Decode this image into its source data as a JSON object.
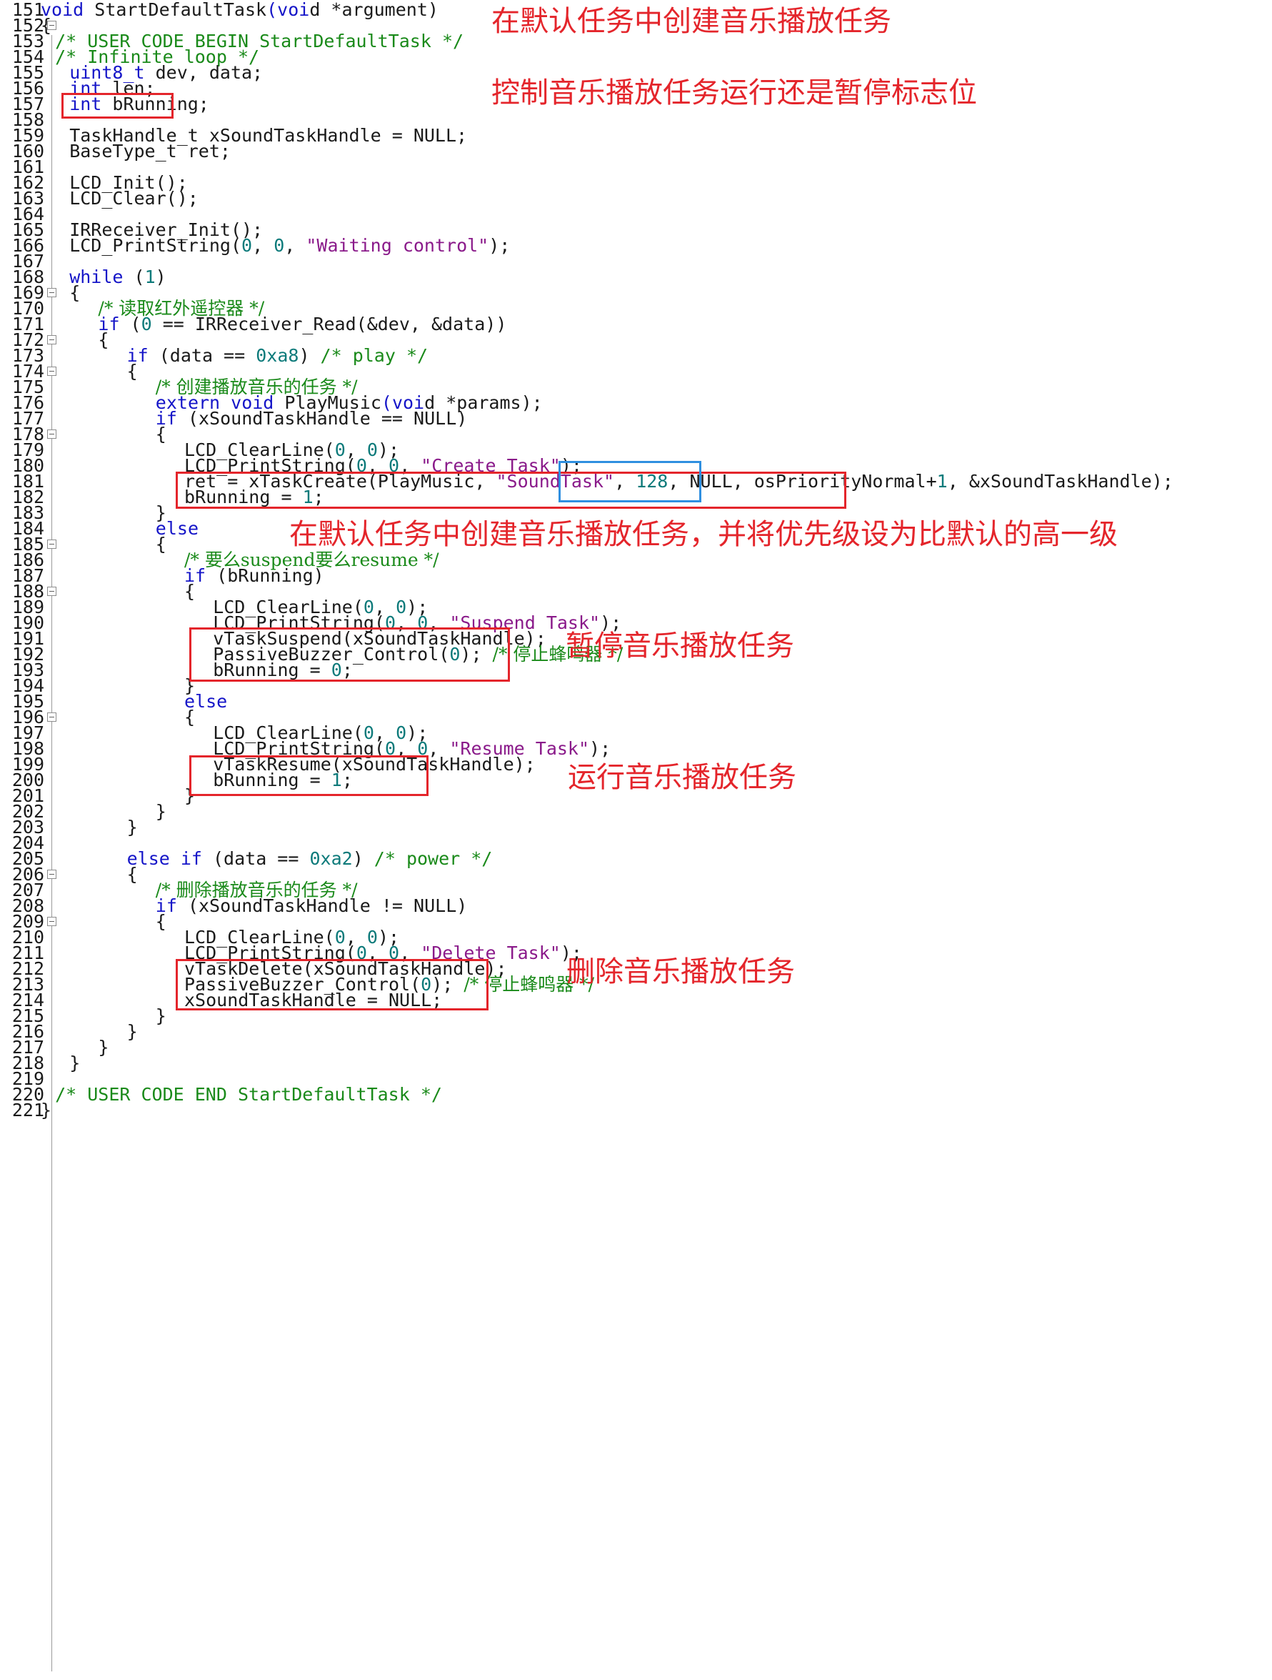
{
  "lines": {
    "l151": {
      "n": "151",
      "t": "void StartDefaultTask(void *argument)"
    },
    "l152": {
      "n": "152",
      "t": "{"
    },
    "l153": {
      "n": "153",
      "t": "/* USER CODE BEGIN StartDefaultTask */"
    },
    "l154": {
      "n": "154",
      "t": "/* Infinite loop */"
    },
    "l155": {
      "n": "155",
      "t": "uint8_t dev, data;"
    },
    "l156": {
      "n": "156",
      "t": "int len;"
    },
    "l157": {
      "n": "157",
      "t": "int bRunning;"
    },
    "l158": {
      "n": "158",
      "t": ""
    },
    "l159": {
      "n": "159",
      "t": "TaskHandle_t xSoundTaskHandle = NULL;"
    },
    "l160": {
      "n": "160",
      "t": "BaseType_t ret;"
    },
    "l161": {
      "n": "161",
      "t": ""
    },
    "l162": {
      "n": "162",
      "t": "LCD_Init();"
    },
    "l163": {
      "n": "163",
      "t": "LCD_Clear();"
    },
    "l164": {
      "n": "164",
      "t": ""
    },
    "l165": {
      "n": "165",
      "t": "IRReceiver_Init();"
    },
    "l166": {
      "n": "166",
      "t": "LCD_PrintString(0, 0, \"Waiting control\");"
    },
    "l167": {
      "n": "167",
      "t": ""
    },
    "l168": {
      "n": "168",
      "t": "while (1)"
    },
    "l169": {
      "n": "169",
      "t": "{"
    },
    "l170": {
      "n": "170",
      "t": "/* 读取红外遥控器 */"
    },
    "l171": {
      "n": "171",
      "t": "if (0 == IRReceiver_Read(&dev, &data))"
    },
    "l172": {
      "n": "172",
      "t": "{"
    },
    "l173": {
      "n": "173",
      "t": "if (data == 0xa8) /* play */"
    },
    "l174": {
      "n": "174",
      "t": "{"
    },
    "l175": {
      "n": "175",
      "t": "/* 创建播放音乐的任务 */"
    },
    "l176": {
      "n": "176",
      "t": "extern void PlayMusic(void *params);"
    },
    "l177": {
      "n": "177",
      "t": "if (xSoundTaskHandle == NULL)"
    },
    "l178": {
      "n": "178",
      "t": "{"
    },
    "l179": {
      "n": "179",
      "t": "LCD_ClearLine(0, 0);"
    },
    "l180": {
      "n": "180",
      "t": "LCD_PrintString(0, 0, \"Create Task\");"
    },
    "l181": {
      "n": "181",
      "t": "ret = xTaskCreate(PlayMusic, \"SoundTask\", 128, NULL, osPriorityNormal+1, &xSoundTaskHandle);"
    },
    "l182": {
      "n": "182",
      "t": "bRunning = 1;"
    },
    "l183": {
      "n": "183",
      "t": "}"
    },
    "l184": {
      "n": "184",
      "t": "else"
    },
    "l185": {
      "n": "185",
      "t": "{"
    },
    "l186": {
      "n": "186",
      "t": "/* 要么suspend要么resume */"
    },
    "l187": {
      "n": "187",
      "t": "if (bRunning)"
    },
    "l188": {
      "n": "188",
      "t": "{"
    },
    "l189": {
      "n": "189",
      "t": "LCD_ClearLine(0, 0);"
    },
    "l190": {
      "n": "190",
      "t": "LCD_PrintString(0, 0, \"Suspend Task\");"
    },
    "l191": {
      "n": "191",
      "t": "vTaskSuspend(xSoundTaskHandle);"
    },
    "l192": {
      "n": "192",
      "t": "PassiveBuzzer_Control(0); /* 停止蜂鸣器 */"
    },
    "l193": {
      "n": "193",
      "t": "bRunning = 0;"
    },
    "l194": {
      "n": "194",
      "t": "}"
    },
    "l195": {
      "n": "195",
      "t": "else"
    },
    "l196": {
      "n": "196",
      "t": "{"
    },
    "l197": {
      "n": "197",
      "t": "LCD_ClearLine(0, 0);"
    },
    "l198": {
      "n": "198",
      "t": "LCD_PrintString(0, 0, \"Resume Task\");"
    },
    "l199": {
      "n": "199",
      "t": "vTaskResume(xSoundTaskHandle);"
    },
    "l200": {
      "n": "200",
      "t": "bRunning = 1;"
    },
    "l201": {
      "n": "201",
      "t": "}"
    },
    "l202": {
      "n": "202",
      "t": "}"
    },
    "l203": {
      "n": "203",
      "t": "}"
    },
    "l204": {
      "n": "204",
      "t": ""
    },
    "l205": {
      "n": "205",
      "t": "else if (data == 0xa2) /* power */"
    },
    "l206": {
      "n": "206",
      "t": "{"
    },
    "l207": {
      "n": "207",
      "t": "/* 删除播放音乐的任务 */"
    },
    "l208": {
      "n": "208",
      "t": "if (xSoundTaskHandle != NULL)"
    },
    "l209": {
      "n": "209",
      "t": "{"
    },
    "l210": {
      "n": "210",
      "t": "LCD_ClearLine(0, 0);"
    },
    "l211": {
      "n": "211",
      "t": "LCD_PrintString(0, 0, \"Delete Task\");"
    },
    "l212": {
      "n": "212",
      "t": "vTaskDelete(xSoundTaskHandle);"
    },
    "l213": {
      "n": "213",
      "t": "PassiveBuzzer_Control(0); /* 停止蜂鸣器 */"
    },
    "l214": {
      "n": "214",
      "t": "xSoundTaskHandle = NULL;"
    },
    "l215": {
      "n": "215",
      "t": "}"
    },
    "l216": {
      "n": "216",
      "t": "}"
    },
    "l217": {
      "n": "217",
      "t": "}"
    },
    "l218": {
      "n": "218",
      "t": "}"
    },
    "l219": {
      "n": "219",
      "t": ""
    },
    "l220": {
      "n": "220",
      "t": "/* USER CODE END StartDefaultTask */"
    },
    "l221": {
      "n": "221",
      "t": "}"
    }
  },
  "annotations": {
    "create_task": "在默认任务中创建音乐播放任务",
    "run_flag": "控制音乐播放任务运行还是暂停标志位",
    "create_priority": "在默认任务中创建音乐播放任务，并将优先级设为比默认的高一级",
    "suspend": "暂停音乐播放任务",
    "resume": "运行音乐播放任务",
    "delete": "删除音乐播放任务"
  },
  "colors": {
    "annotation_red": "#e4252b",
    "highlight_blue": "#2f8fe0",
    "keyword": "#1515c8",
    "comment": "#1a8a1a",
    "string": "#8a1a8a",
    "number": "#0c7a7a"
  }
}
